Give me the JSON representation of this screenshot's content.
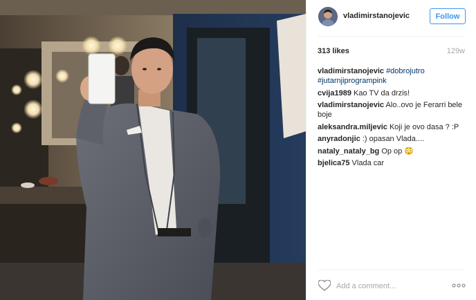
{
  "post": {
    "username": "vladimirstanojevic",
    "follow_label": "Follow",
    "likes": "313 likes",
    "time": "129w",
    "caption": {
      "user": "vladimirstanojevic",
      "tags": [
        "#dobrojutro",
        "#jutarnjiprogrampink"
      ]
    },
    "comments": [
      {
        "user": "cvija1989",
        "text": "Kao TV da drzis!"
      },
      {
        "user": "vladimirstanojevic",
        "text": "Alo..ovo je Ferarri bele boje"
      },
      {
        "user": "aleksandra.miljevic",
        "text": "Koji je ovo dasa ? :P"
      },
      {
        "user": "anyradonjic",
        "text": ":) opasan Vlada...."
      },
      {
        "user": "nataly_nataly_bg",
        "text": "Op op 😳"
      },
      {
        "user": "bjelica75",
        "text": "Vlada car"
      }
    ],
    "add_comment_placeholder": "Add a comment...",
    "icons": {
      "like": "heart-outline-icon",
      "more": "more-options-icon"
    },
    "colors": {
      "link_blue": "#3897f0",
      "hashtag": "#003569",
      "text": "#262626",
      "muted": "#a5a7aa"
    }
  }
}
